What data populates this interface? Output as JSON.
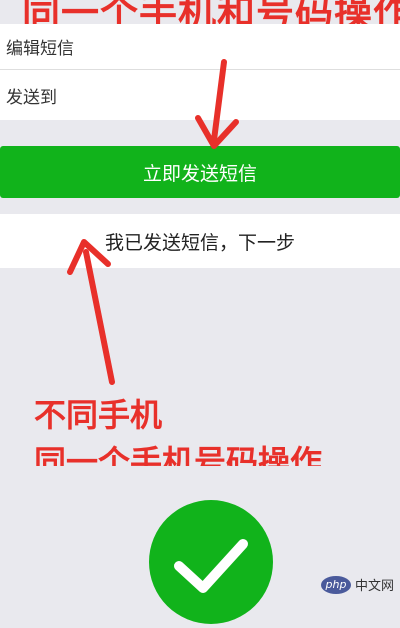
{
  "annotations": {
    "top_caption": "同一个手机和号码操作",
    "caption_line_1": "不同手机",
    "caption_line_2": "同一个手机号码操作"
  },
  "form": {
    "edit_sms_label": "编辑短信",
    "send_to_label": "发送到"
  },
  "buttons": {
    "send_now_label": "立即发送短信",
    "next_step_label": "我已发送短信，下一步"
  },
  "watermark": {
    "logo_text": "php",
    "site_text": "中文网"
  },
  "colors": {
    "accent_green": "#11b31b",
    "annotation_red": "#e8302a",
    "background": "#e9e9ee"
  },
  "icons": [
    "checkmark-icon"
  ]
}
